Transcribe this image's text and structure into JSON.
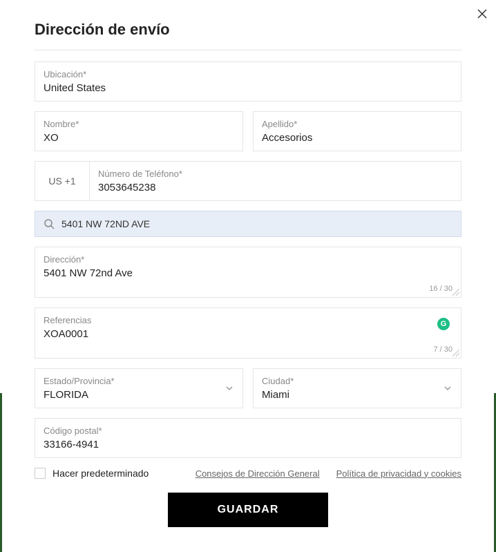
{
  "title": "Dirección de envío",
  "location": {
    "label": "Ubicación*",
    "value": "United States"
  },
  "firstName": {
    "label": "Nombre*",
    "value": "XO"
  },
  "lastName": {
    "label": "Apellido*",
    "value": "Accesorios"
  },
  "phone": {
    "prefix": "US +1",
    "label": "Número de Teléfono*",
    "value": "3053645238"
  },
  "search": {
    "value": "5401 NW 72ND AVE"
  },
  "address": {
    "label": "Dirección*",
    "value": "5401 NW 72nd Ave",
    "counter": "16 / 30"
  },
  "references": {
    "label": "Referencias",
    "value": "XOA0001",
    "counter": "7 / 30"
  },
  "state": {
    "label": "Estado/Provincia*",
    "value": "FLORIDA"
  },
  "city": {
    "label": "Ciudad*",
    "value": "Miami"
  },
  "postal": {
    "label": "Código postal*",
    "value": "33166-4941"
  },
  "defaultCheckbox": "Hacer predeterminado",
  "links": {
    "tips": "Consejos de Dirección General",
    "privacy": "Política de privacidad y cookies"
  },
  "saveButton": "GUARDAR",
  "grammarlyBadge": "G"
}
